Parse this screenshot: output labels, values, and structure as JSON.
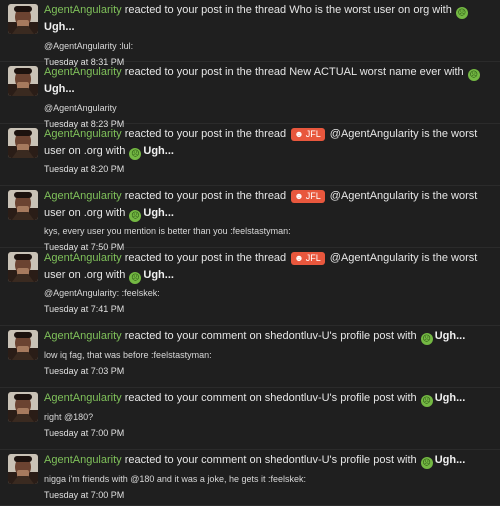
{
  "alerts": [
    {
      "user": "AgentAngularity",
      "before": "reacted to your post in the thread",
      "prefix": "",
      "after": "Who is the worst user on org with",
      "reaction": "Ugh...",
      "snippet": "@AgentAngularity :lul:",
      "time": "Tuesday at 8:31 PM"
    },
    {
      "user": "AgentAngularity",
      "before": "reacted to your post in the thread",
      "prefix": "",
      "after": "New ACTUAL worst name ever with",
      "reaction": "Ugh...",
      "snippet": "@AgentAngularity",
      "time": "Tuesday at 8:23 PM"
    },
    {
      "user": "AgentAngularity",
      "before": "reacted to your post in the thread",
      "prefix": "JFL",
      "after": "@AgentAngularity is the worst user on .org with",
      "reaction": "Ugh...",
      "snippet": "",
      "time": "Tuesday at 8:20 PM"
    },
    {
      "user": "AgentAngularity",
      "before": "reacted to your post in the thread",
      "prefix": "JFL",
      "after": "@AgentAngularity is the worst user on .org with",
      "reaction": "Ugh...",
      "snippet": "kys, every user you mention is better than you :feelstastyman:",
      "time": "Tuesday at 7:50 PM"
    },
    {
      "user": "AgentAngularity",
      "before": "reacted to your post in the thread",
      "prefix": "JFL",
      "after": "@AgentAngularity is the worst user on .org with",
      "reaction": "Ugh...",
      "snippet": "@AgentAngularity: :feelskek:",
      "time": "Tuesday at 7:41 PM"
    },
    {
      "user": "AgentAngularity",
      "before": "reacted to your comment on shedontluv-U's profile post with",
      "prefix": "",
      "after": "",
      "reaction": "Ugh...",
      "snippet": "low iq fag, that was before :feelstastyman:",
      "time": "Tuesday at 7:03 PM"
    },
    {
      "user": "AgentAngularity",
      "before": "reacted to your comment on shedontluv-U's profile post with",
      "prefix": "",
      "after": "",
      "reaction": "Ugh...",
      "snippet": "right @180?",
      "time": "Tuesday at 7:00 PM"
    },
    {
      "user": "AgentAngularity",
      "before": "reacted to your comment on shedontluv-U's profile post with",
      "prefix": "",
      "after": "",
      "reaction": "Ugh...",
      "snippet": "nigga i'm friends with @180 and it was a joke, he gets it :feelskek:",
      "time": "Tuesday at 7:00 PM"
    }
  ],
  "reaction_icon": "sick-face-emoji",
  "prefix_icon": "laughing-face-icon",
  "colors": {
    "background": "#1f1f1f",
    "username": "#7fc05a",
    "prefix_bg": "#e8573d",
    "emoji": "#74b843"
  }
}
